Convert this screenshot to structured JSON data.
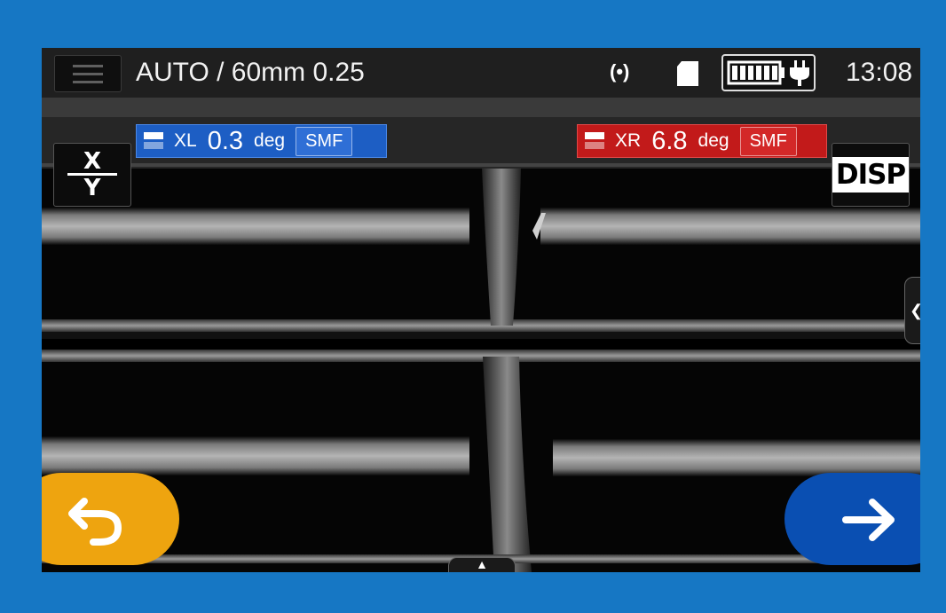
{
  "header": {
    "mode_title": "AUTO / 60mm 0.25",
    "time": "13:08",
    "icons": [
      "menu-icon",
      "wireless-signal-icon",
      "sd-card-icon",
      "battery-charging-icon"
    ]
  },
  "left_fiber": {
    "label": "XL",
    "angle": "0.3",
    "unit": "deg",
    "fiber_type": "SMF",
    "color": "#1d5ec4"
  },
  "right_fiber": {
    "label": "XR",
    "angle": "6.8",
    "unit": "deg",
    "fiber_type": "SMF",
    "color": "#c21a1a"
  },
  "controls": {
    "xy_top": "X",
    "xy_bottom": "Y",
    "disp_label": "DISP",
    "back_color": "#eea40f",
    "next_color": "#0a4fb2"
  },
  "battery": {
    "level": 1.0
  }
}
